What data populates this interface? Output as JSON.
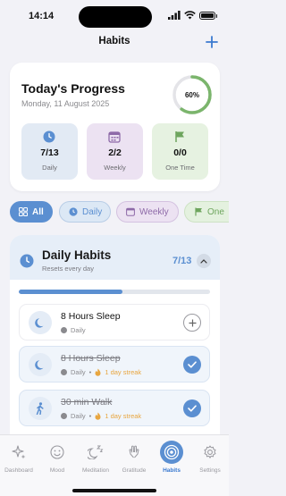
{
  "status_bar": {
    "time": "14:14"
  },
  "nav": {
    "title": "Habits"
  },
  "progress": {
    "title": "Today's Progress",
    "date": "Monday, 11 August 2025",
    "percent_label": "60%",
    "percent_value": 0.6,
    "stats": [
      {
        "value": "7/13",
        "label": "Daily",
        "icon": "clock-icon",
        "color": "#5b8fd1",
        "bg": "#e2eaf4"
      },
      {
        "value": "2/2",
        "label": "Weekly",
        "icon": "calendar-icon",
        "color": "#8e6aa8",
        "bg": "#ece2f2"
      },
      {
        "value": "0/0",
        "label": "One Time",
        "icon": "flag-icon",
        "color": "#6ea55e",
        "bg": "#e6f2e1"
      }
    ]
  },
  "filters": [
    {
      "label": "All",
      "icon": "grid-icon",
      "selected": true
    },
    {
      "label": "Daily",
      "icon": "clock-icon",
      "selected": false
    },
    {
      "label": "Weekly",
      "icon": "calendar-icon",
      "selected": false
    },
    {
      "label": "One",
      "icon": "flag-icon",
      "selected": false
    }
  ],
  "daily_section": {
    "title": "Daily Habits",
    "subtitle": "Resets every day",
    "count": "7/13",
    "progress": 0.54,
    "habits": [
      {
        "name": "8 Hours Sleep",
        "frequency": "Daily",
        "streak": "",
        "done": false,
        "icon": "moon-icon"
      },
      {
        "name": "8 Hours Sleep",
        "frequency": "Daily",
        "streak": "1 day streak",
        "done": true,
        "icon": "moon-icon"
      },
      {
        "name": "30 min Walk",
        "frequency": "Daily",
        "streak": "1 day streak",
        "done": true,
        "icon": "walk-icon"
      }
    ]
  },
  "tabs": [
    {
      "label": "Dashboard",
      "icon": "sparkle-icon",
      "active": false
    },
    {
      "label": "Mood",
      "icon": "smiley-icon",
      "active": false
    },
    {
      "label": "Meditation",
      "icon": "moon-zz-icon",
      "active": false
    },
    {
      "label": "Gratitude",
      "icon": "hands-icon",
      "active": false
    },
    {
      "label": "Habits",
      "icon": "target-icon",
      "active": true
    },
    {
      "label": "Settings",
      "icon": "gear-icon",
      "active": false
    }
  ],
  "colors": {
    "accent": "#5b8fd1",
    "ring": "#7bb56c",
    "streak": "#e8a640"
  }
}
